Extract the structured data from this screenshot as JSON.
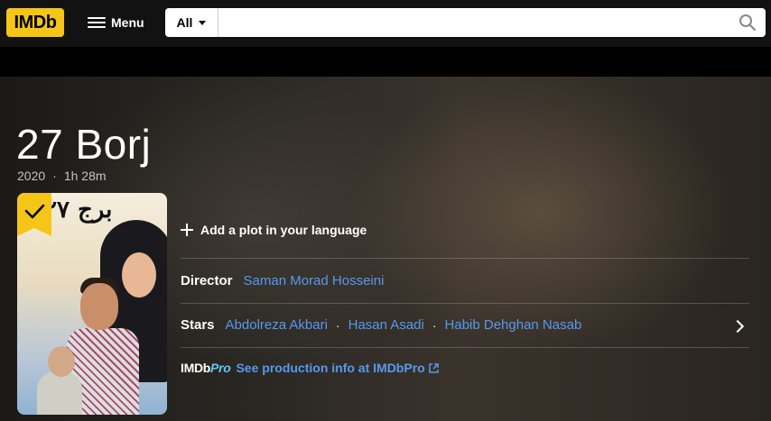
{
  "nav": {
    "logo": "IMDb",
    "menu_label": "Menu",
    "search_category": "All",
    "search_value": "",
    "search_placeholder": ""
  },
  "title": {
    "name": "27 Borj",
    "year": "2020",
    "runtime": "1h 28m"
  },
  "poster": {
    "title_text": "برج ۲۷",
    "watchlist_added": true
  },
  "plot": {
    "add_label": "Add a plot in your language"
  },
  "credits": {
    "director_label": "Director",
    "directors": [
      "Saman Morad Hosseini"
    ],
    "stars_label": "Stars",
    "stars": [
      "Abdolreza Akbari",
      "Hasan Asadi",
      "Habib Dehghan Nasab"
    ]
  },
  "pro": {
    "logo_imdb": "IMDb",
    "logo_pro": "Pro",
    "link_label": "See production info at IMDbPro"
  },
  "colors": {
    "brand_yellow": "#f5c518",
    "link_blue": "#5799ef",
    "pro_blue": "#5cc8ff"
  }
}
